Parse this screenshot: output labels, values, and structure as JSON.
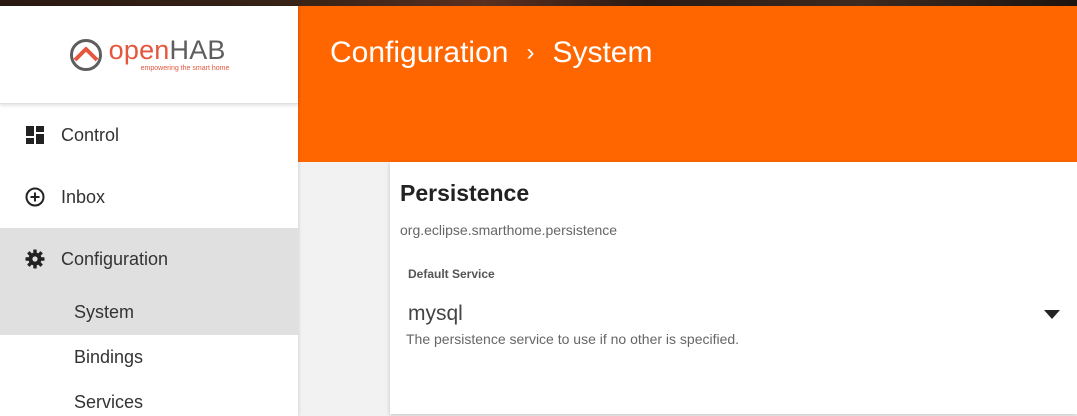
{
  "brand": {
    "name_part1": "open",
    "name_part2": "HAB",
    "tagline": "empowering the smart home"
  },
  "sidebar": {
    "items": [
      {
        "label": "Control",
        "icon": "dashboard-icon"
      },
      {
        "label": "Inbox",
        "icon": "add-circle-icon"
      },
      {
        "label": "Configuration",
        "icon": "gear-icon"
      }
    ],
    "subitems": [
      {
        "label": "System"
      },
      {
        "label": "Bindings"
      },
      {
        "label": "Services"
      }
    ]
  },
  "header": {
    "crumb1": "Configuration",
    "separator": "›",
    "crumb2": "System"
  },
  "card": {
    "title": "Persistence",
    "pid": "org.eclipse.smarthome.persistence",
    "field_label": "Default Service",
    "select_value": "mysql",
    "hint": "The persistence service to use if no other is specified."
  },
  "colors": {
    "accent": "#ff6600",
    "logo": "#e4573d"
  }
}
